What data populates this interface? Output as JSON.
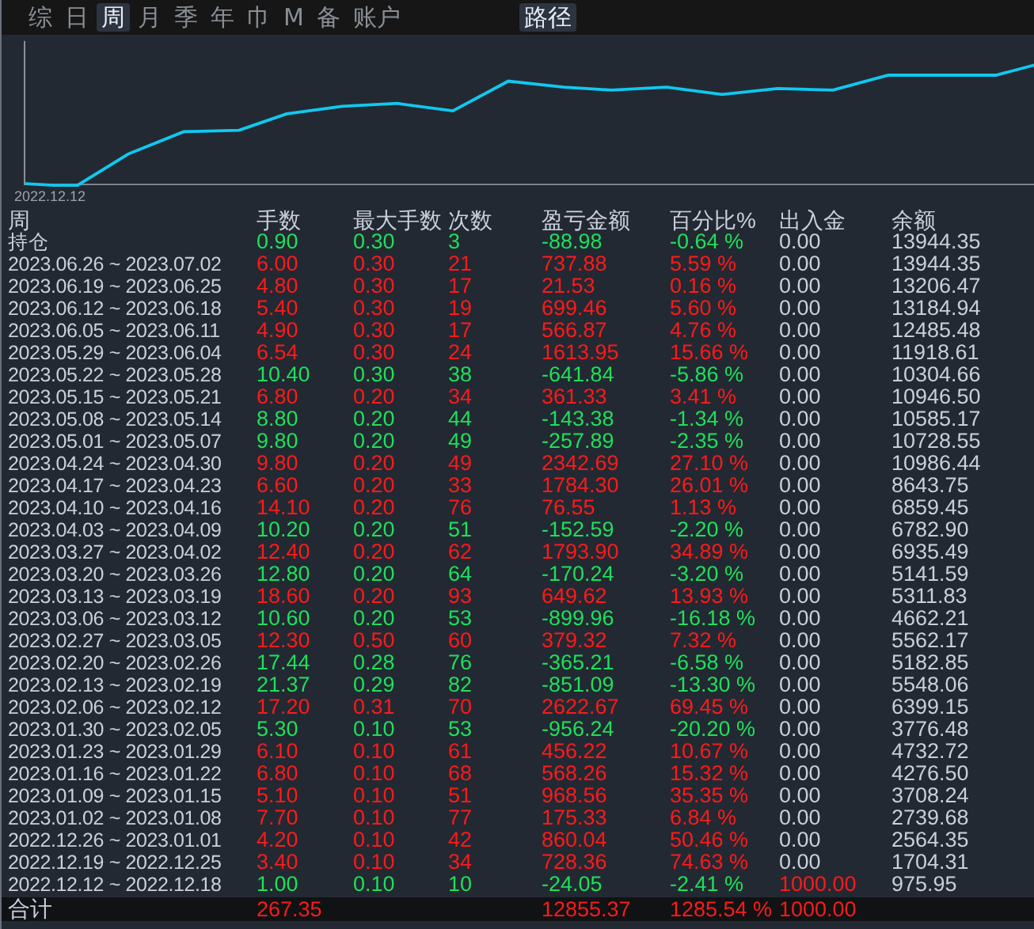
{
  "tabs": [
    {
      "label": "综",
      "selected": false
    },
    {
      "label": "日",
      "selected": false
    },
    {
      "label": "周",
      "selected": true
    },
    {
      "label": "月",
      "selected": false
    },
    {
      "label": "季",
      "selected": false
    },
    {
      "label": "年",
      "selected": false
    },
    {
      "label": "巾",
      "selected": false
    },
    {
      "label": "M",
      "selected": false
    },
    {
      "label": "备",
      "selected": false
    },
    {
      "label": "账户",
      "selected": false
    }
  ],
  "path_tab": {
    "label": "路径",
    "selected": true
  },
  "chart": {
    "start_label": "2022.12.12"
  },
  "table": {
    "columns": [
      "周",
      "手数",
      "最大手数",
      "次数",
      "盈亏金额",
      "百分比%",
      "出入金",
      "余额"
    ],
    "rows": [
      {
        "period": "持仓",
        "kind": "loss",
        "lots": "0.90",
        "max_lots": "0.30",
        "count": "3",
        "pnl": "-88.98",
        "pct": "-0.64 %",
        "deposit": "0.00",
        "deposit_highlight": false,
        "balance": "13944.35"
      },
      {
        "period": "2023.06.26 ~ 2023.07.02",
        "kind": "gain",
        "lots": "6.00",
        "max_lots": "0.30",
        "count": "21",
        "pnl": "737.88",
        "pct": "5.59 %",
        "deposit": "0.00",
        "deposit_highlight": false,
        "balance": "13944.35"
      },
      {
        "period": "2023.06.19 ~ 2023.06.25",
        "kind": "gain",
        "lots": "4.80",
        "max_lots": "0.30",
        "count": "17",
        "pnl": "21.53",
        "pct": "0.16 %",
        "deposit": "0.00",
        "deposit_highlight": false,
        "balance": "13206.47"
      },
      {
        "period": "2023.06.12 ~ 2023.06.18",
        "kind": "gain",
        "lots": "5.40",
        "max_lots": "0.30",
        "count": "19",
        "pnl": "699.46",
        "pct": "5.60 %",
        "deposit": "0.00",
        "deposit_highlight": false,
        "balance": "13184.94"
      },
      {
        "period": "2023.06.05 ~ 2023.06.11",
        "kind": "gain",
        "lots": "4.90",
        "max_lots": "0.30",
        "count": "17",
        "pnl": "566.87",
        "pct": "4.76 %",
        "deposit": "0.00",
        "deposit_highlight": false,
        "balance": "12485.48"
      },
      {
        "period": "2023.05.29 ~ 2023.06.04",
        "kind": "gain",
        "lots": "6.54",
        "max_lots": "0.30",
        "count": "24",
        "pnl": "1613.95",
        "pct": "15.66 %",
        "deposit": "0.00",
        "deposit_highlight": false,
        "balance": "11918.61"
      },
      {
        "period": "2023.05.22 ~ 2023.05.28",
        "kind": "loss",
        "lots": "10.40",
        "max_lots": "0.30",
        "count": "38",
        "pnl": "-641.84",
        "pct": "-5.86 %",
        "deposit": "0.00",
        "deposit_highlight": false,
        "balance": "10304.66"
      },
      {
        "period": "2023.05.15 ~ 2023.05.21",
        "kind": "gain",
        "lots": "6.80",
        "max_lots": "0.20",
        "count": "34",
        "pnl": "361.33",
        "pct": "3.41 %",
        "deposit": "0.00",
        "deposit_highlight": false,
        "balance": "10946.50"
      },
      {
        "period": "2023.05.08 ~ 2023.05.14",
        "kind": "loss",
        "lots": "8.80",
        "max_lots": "0.20",
        "count": "44",
        "pnl": "-143.38",
        "pct": "-1.34 %",
        "deposit": "0.00",
        "deposit_highlight": false,
        "balance": "10585.17"
      },
      {
        "period": "2023.05.01 ~ 2023.05.07",
        "kind": "loss",
        "lots": "9.80",
        "max_lots": "0.20",
        "count": "49",
        "pnl": "-257.89",
        "pct": "-2.35 %",
        "deposit": "0.00",
        "deposit_highlight": false,
        "balance": "10728.55"
      },
      {
        "period": "2023.04.24 ~ 2023.04.30",
        "kind": "gain",
        "lots": "9.80",
        "max_lots": "0.20",
        "count": "49",
        "pnl": "2342.69",
        "pct": "27.10 %",
        "deposit": "0.00",
        "deposit_highlight": false,
        "balance": "10986.44"
      },
      {
        "period": "2023.04.17 ~ 2023.04.23",
        "kind": "gain",
        "lots": "6.60",
        "max_lots": "0.20",
        "count": "33",
        "pnl": "1784.30",
        "pct": "26.01 %",
        "deposit": "0.00",
        "deposit_highlight": false,
        "balance": "8643.75"
      },
      {
        "period": "2023.04.10 ~ 2023.04.16",
        "kind": "gain",
        "lots": "14.10",
        "max_lots": "0.20",
        "count": "76",
        "pnl": "76.55",
        "pct": "1.13 %",
        "deposit": "0.00",
        "deposit_highlight": false,
        "balance": "6859.45"
      },
      {
        "period": "2023.04.03 ~ 2023.04.09",
        "kind": "loss",
        "lots": "10.20",
        "max_lots": "0.20",
        "count": "51",
        "pnl": "-152.59",
        "pct": "-2.20 %",
        "deposit": "0.00",
        "deposit_highlight": false,
        "balance": "6782.90"
      },
      {
        "period": "2023.03.27 ~ 2023.04.02",
        "kind": "gain",
        "lots": "12.40",
        "max_lots": "0.20",
        "count": "62",
        "pnl": "1793.90",
        "pct": "34.89 %",
        "deposit": "0.00",
        "deposit_highlight": false,
        "balance": "6935.49"
      },
      {
        "period": "2023.03.20 ~ 2023.03.26",
        "kind": "loss",
        "lots": "12.80",
        "max_lots": "0.20",
        "count": "64",
        "pnl": "-170.24",
        "pct": "-3.20 %",
        "deposit": "0.00",
        "deposit_highlight": false,
        "balance": "5141.59"
      },
      {
        "period": "2023.03.13 ~ 2023.03.19",
        "kind": "gain",
        "lots": "18.60",
        "max_lots": "0.20",
        "count": "93",
        "pnl": "649.62",
        "pct": "13.93 %",
        "deposit": "0.00",
        "deposit_highlight": false,
        "balance": "5311.83"
      },
      {
        "period": "2023.03.06 ~ 2023.03.12",
        "kind": "loss",
        "lots": "10.60",
        "max_lots": "0.20",
        "count": "53",
        "pnl": "-899.96",
        "pct": "-16.18 %",
        "deposit": "0.00",
        "deposit_highlight": false,
        "balance": "4662.21"
      },
      {
        "period": "2023.02.27 ~ 2023.03.05",
        "kind": "gain",
        "lots": "12.30",
        "max_lots": "0.50",
        "count": "60",
        "pnl": "379.32",
        "pct": "7.32 %",
        "deposit": "0.00",
        "deposit_highlight": false,
        "balance": "5562.17"
      },
      {
        "period": "2023.02.20 ~ 2023.02.26",
        "kind": "loss",
        "lots": "17.44",
        "max_lots": "0.28",
        "count": "76",
        "pnl": "-365.21",
        "pct": "-6.58 %",
        "deposit": "0.00",
        "deposit_highlight": false,
        "balance": "5182.85"
      },
      {
        "period": "2023.02.13 ~ 2023.02.19",
        "kind": "loss",
        "lots": "21.37",
        "max_lots": "0.29",
        "count": "82",
        "pnl": "-851.09",
        "pct": "-13.30 %",
        "deposit": "0.00",
        "deposit_highlight": false,
        "balance": "5548.06"
      },
      {
        "period": "2023.02.06 ~ 2023.02.12",
        "kind": "gain",
        "lots": "17.20",
        "max_lots": "0.31",
        "count": "70",
        "pnl": "2622.67",
        "pct": "69.45 %",
        "deposit": "0.00",
        "deposit_highlight": false,
        "balance": "6399.15"
      },
      {
        "period": "2023.01.30 ~ 2023.02.05",
        "kind": "loss",
        "lots": "5.30",
        "max_lots": "0.10",
        "count": "53",
        "pnl": "-956.24",
        "pct": "-20.20 %",
        "deposit": "0.00",
        "deposit_highlight": false,
        "balance": "3776.48"
      },
      {
        "period": "2023.01.23 ~ 2023.01.29",
        "kind": "gain",
        "lots": "6.10",
        "max_lots": "0.10",
        "count": "61",
        "pnl": "456.22",
        "pct": "10.67 %",
        "deposit": "0.00",
        "deposit_highlight": false,
        "balance": "4732.72"
      },
      {
        "period": "2023.01.16 ~ 2023.01.22",
        "kind": "gain",
        "lots": "6.80",
        "max_lots": "0.10",
        "count": "68",
        "pnl": "568.26",
        "pct": "15.32 %",
        "deposit": "0.00",
        "deposit_highlight": false,
        "balance": "4276.50"
      },
      {
        "period": "2023.01.09 ~ 2023.01.15",
        "kind": "gain",
        "lots": "5.10",
        "max_lots": "0.10",
        "count": "51",
        "pnl": "968.56",
        "pct": "35.35 %",
        "deposit": "0.00",
        "deposit_highlight": false,
        "balance": "3708.24"
      },
      {
        "period": "2023.01.02 ~ 2023.01.08",
        "kind": "gain",
        "lots": "7.70",
        "max_lots": "0.10",
        "count": "77",
        "pnl": "175.33",
        "pct": "6.84 %",
        "deposit": "0.00",
        "deposit_highlight": false,
        "balance": "2739.68"
      },
      {
        "period": "2022.12.26 ~ 2023.01.01",
        "kind": "gain",
        "lots": "4.20",
        "max_lots": "0.10",
        "count": "42",
        "pnl": "860.04",
        "pct": "50.46 %",
        "deposit": "0.00",
        "deposit_highlight": false,
        "balance": "2564.35"
      },
      {
        "period": "2022.12.19 ~ 2022.12.25",
        "kind": "gain",
        "lots": "3.40",
        "max_lots": "0.10",
        "count": "34",
        "pnl": "728.36",
        "pct": "74.63 %",
        "deposit": "0.00",
        "deposit_highlight": false,
        "balance": "1704.31"
      },
      {
        "period": "2022.12.12 ~ 2022.12.18",
        "kind": "loss",
        "lots": "1.00",
        "max_lots": "0.10",
        "count": "10",
        "pnl": "-24.05",
        "pct": "-2.41 %",
        "deposit": "1000.00",
        "deposit_highlight": true,
        "balance": "975.95"
      }
    ],
    "total": {
      "label": "合计",
      "lots": "267.35",
      "pnl": "12855.37",
      "pct": "1285.54 %",
      "deposit": "1000.00"
    }
  }
}
